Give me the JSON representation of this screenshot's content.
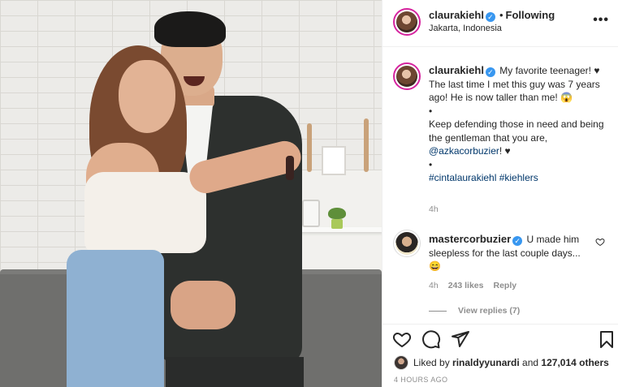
{
  "post": {
    "username": "claurakiehl",
    "following_label": "Following",
    "location": "Jakarta, Indonesia",
    "more_label": "•••"
  },
  "caption": {
    "username": "claurakiehl",
    "line1": " My favorite teenager! ♥ The last time I met this guy was 7 years ago! He is now taller than me! 😱",
    "bullet1": "•",
    "line2": "Keep defending those in need and being the gentleman that you are,",
    "mention": "@azkacorbuzier",
    "line2_end": "! ♥",
    "bullet2": "•",
    "hashtags": "#cintalaurakiehl #kiehlers",
    "time": "4h"
  },
  "reply": {
    "username": "mastercorbuzier",
    "text": " U made him sleepless for the last couple days... 😄",
    "time": "4h",
    "likes": "243 likes",
    "reply_label": "Reply",
    "view_replies": "View replies (7)"
  },
  "footer": {
    "liked_prefix": "Liked by ",
    "liked_user": "rinaldyyunardi",
    "liked_mid": " and ",
    "liked_count": "127,014 others",
    "post_time": "4 HOURS AGO"
  },
  "icons": {
    "verified": "verified-badge-icon",
    "heart": "heart-icon",
    "comment": "comment-icon",
    "share": "share-icon",
    "save": "bookmark-icon"
  },
  "colors": {
    "verified": "#3897f0",
    "link": "#00376b",
    "muted": "#8e8e8e",
    "story_ring": "#d6249f"
  }
}
